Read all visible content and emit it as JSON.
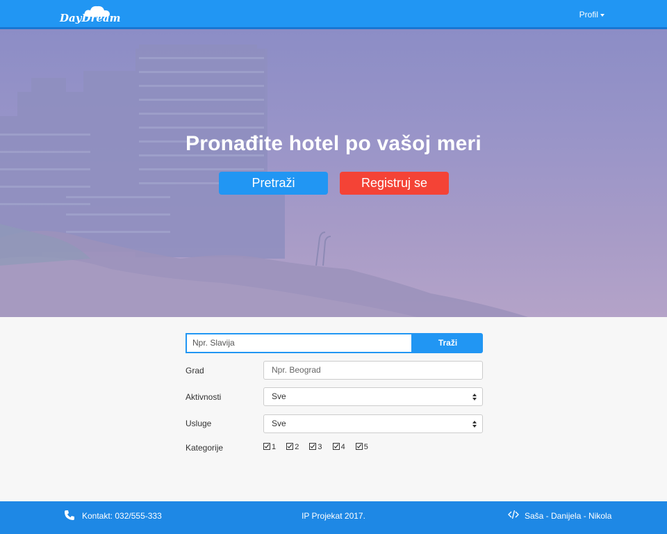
{
  "navbar": {
    "logo_text": "DayDream",
    "profile_label": "Profil",
    "colors": {
      "bar": "#2196f3",
      "border": "#1976d2"
    }
  },
  "hero": {
    "title": "Pronađite hotel po vašoj meri",
    "search_button": "Pretraži",
    "register_button": "Registruj se",
    "colors": {
      "search": "#2196f3",
      "register": "#f44336"
    }
  },
  "search": {
    "placeholder": "Npr. Slavija",
    "button_label": "Traži"
  },
  "filters": {
    "city": {
      "label": "Grad",
      "placeholder": "Npr. Beograd"
    },
    "activities": {
      "label": "Aktivnosti",
      "selected": "Sve"
    },
    "services": {
      "label": "Usluge",
      "selected": "Sve"
    },
    "categories": {
      "label": "Kategorije",
      "options": [
        "1",
        "2",
        "3",
        "4",
        "5"
      ]
    }
  },
  "footer": {
    "contact": "Kontakt: 032/555-333",
    "center": "IP Projekat 2017.",
    "authors": "Saša - Danijela - Nikola",
    "color": "#1e88e5"
  }
}
